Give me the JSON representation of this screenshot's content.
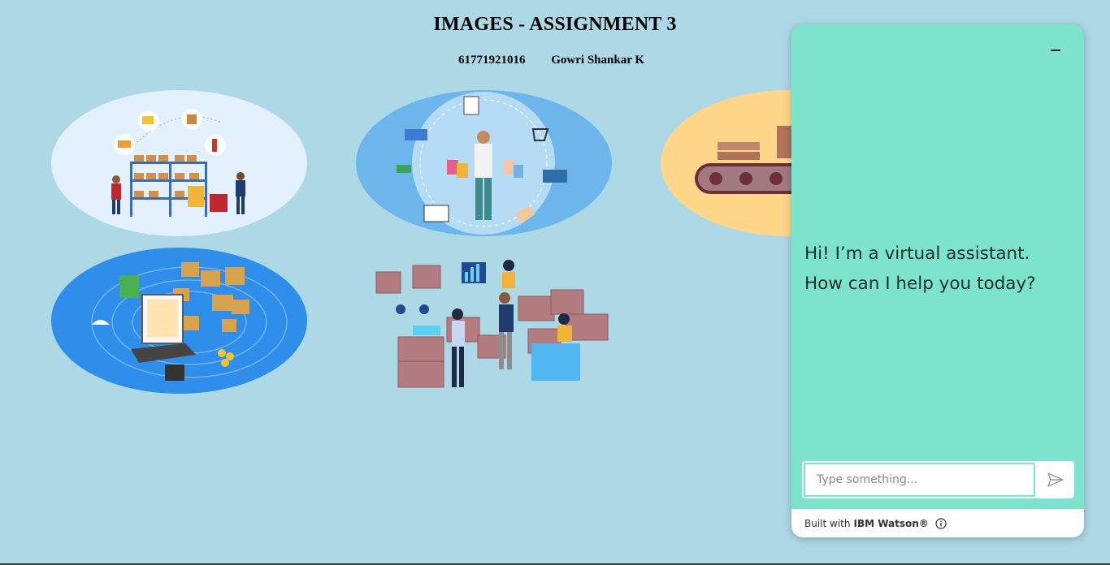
{
  "page": {
    "title": "IMAGES - ASSIGNMENT 3",
    "student_id": "61771921016",
    "student_name": "Gowri Shankar K"
  },
  "images": [
    {
      "name": "warehouse-shelves-illustration",
      "bg": "#e3f0fd"
    },
    {
      "name": "shopping-person-illustration",
      "bg": "#6cb6ec"
    },
    {
      "name": "conveyor-belt-illustration",
      "bg": "#ffd68a"
    },
    {
      "name": "inventory-laptop-illustration",
      "bg": "#2f8ee9"
    },
    {
      "name": "warehouse-workers-boxes-illustration",
      "bg": "#add8e6"
    }
  ],
  "chat": {
    "greeting": "Hi! I’m a virtual assistant. How can I help you today?",
    "input_placeholder": "Type something...",
    "footer_prefix": "Built with",
    "footer_brand": "IBM Watson®",
    "accent": "#7ce3cc",
    "icons": {
      "minimize": "minimize-icon",
      "send": "send-icon",
      "info": "info-icon"
    }
  }
}
